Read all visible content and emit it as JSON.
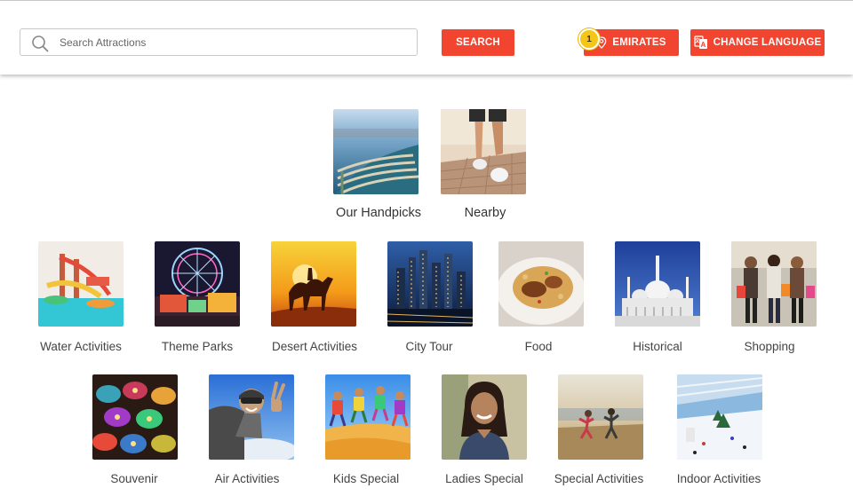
{
  "header": {
    "search_placeholder": "Search Attractions",
    "search_button": "SEARCH",
    "location_button": "EMIRATES",
    "location_badge": "1",
    "language_button": "CHANGE LANGUAGE"
  },
  "colors": {
    "accent": "#f2452f",
    "badge": "#f5c518"
  },
  "featured": [
    {
      "label": "Our Handpicks",
      "icon": "palm-island-photo"
    },
    {
      "label": "Nearby",
      "icon": "walking-feet-photo"
    }
  ],
  "categories_row1": [
    {
      "label": "Water Activities",
      "icon": "waterpark-photo"
    },
    {
      "label": "Theme Parks",
      "icon": "ferris-wheel-photo"
    },
    {
      "label": "Desert Activities",
      "icon": "camel-sunset-photo"
    },
    {
      "label": "City Tour",
      "icon": "skyline-night-photo"
    },
    {
      "label": "Food",
      "icon": "food-plate-photo"
    },
    {
      "label": "Historical",
      "icon": "mosque-photo"
    },
    {
      "label": "Shopping",
      "icon": "shoppers-photo"
    }
  ],
  "categories_row2": [
    {
      "label": "Souvenir",
      "icon": "lanterns-photo"
    },
    {
      "label": "Air Activities",
      "icon": "skydiver-photo"
    },
    {
      "label": "Kids Special",
      "icon": "jumping-kids-photo"
    },
    {
      "label": "Ladies Special",
      "icon": "smiling-woman-photo"
    },
    {
      "label": "Special Activities",
      "icon": "beach-run-photo"
    },
    {
      "label": "Indoor Activities",
      "icon": "ski-slope-photo"
    }
  ]
}
